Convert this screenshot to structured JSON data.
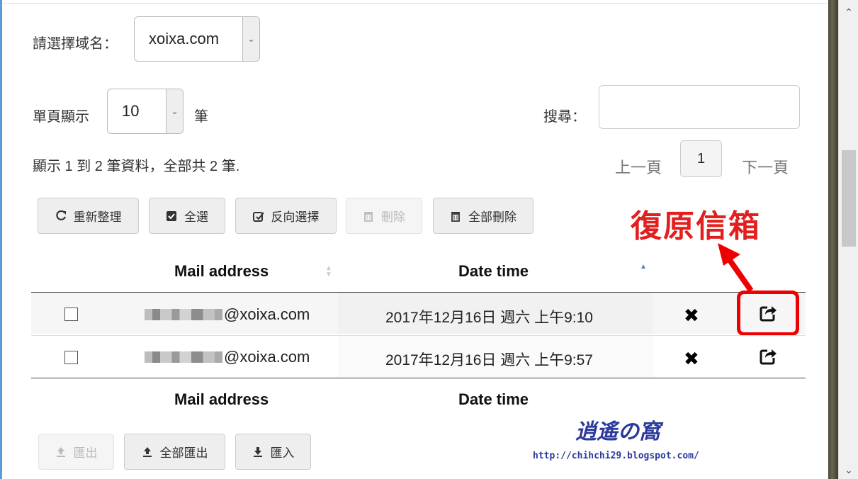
{
  "domain_label": "請選擇域名：",
  "domain_value": "xoixa.com",
  "page_size": {
    "label_prefix": "單頁顯示",
    "value": "10",
    "label_suffix": "筆"
  },
  "search": {
    "label": "搜尋：",
    "placeholder": ""
  },
  "summary": "顯示 1 到 2 筆資料，全部共 2 筆.",
  "pager": {
    "prev": "上一頁",
    "current": "1",
    "next": "下一頁"
  },
  "toolbar": {
    "refresh": "重新整理",
    "select_all": "全選",
    "invert": "反向選擇",
    "delete": "刪除",
    "delete_all": "全部刪除"
  },
  "annotation": "復原信箱",
  "columns": {
    "mail": "Mail address",
    "date": "Date time"
  },
  "rows": [
    {
      "email_domain": "@xoixa.com",
      "date": "2017年12月16日 週六 上午9:10"
    },
    {
      "email_domain": "@xoixa.com",
      "date": "2017年12月16日 週六 上午9:57"
    }
  ],
  "bottom_buttons": {
    "export": "匯出",
    "export_all": "全部匯出",
    "import": "匯入"
  },
  "watermark": {
    "title": "逍遙の窩",
    "url": "http://chihchi29.blogspot.com/"
  },
  "colors": {
    "annotation": "#e31e1e",
    "watermark": "#2c3a9c"
  }
}
